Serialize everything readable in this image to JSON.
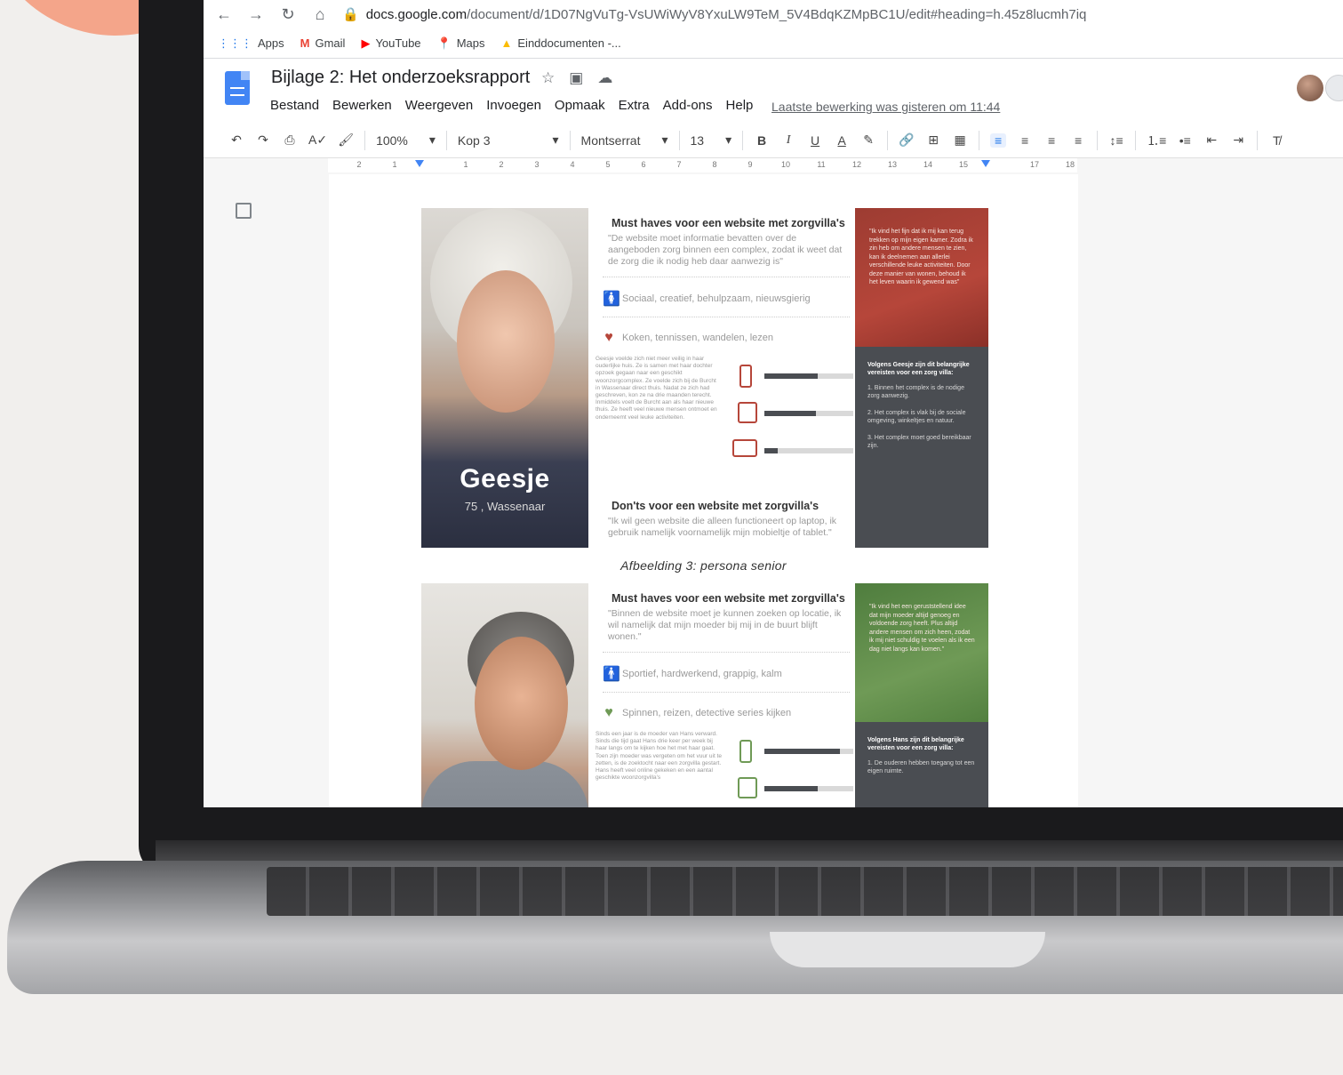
{
  "browser": {
    "url_host": "docs.google.com",
    "url_path": "/document/d/1D07NgVuTg-VsUWiWyV8YxuLW9TeM_5V4BdqKZMpBC1U/edit#heading=h.45z8lucmh7iq",
    "bookmarks": [
      "Apps",
      "Gmail",
      "YouTube",
      "Maps",
      "Einddocumenten -..."
    ]
  },
  "doc": {
    "title": "Bijlage 2: Het onderzoeksrapport",
    "menu": [
      "Bestand",
      "Bewerken",
      "Weergeven",
      "Invoegen",
      "Opmaak",
      "Extra",
      "Add-ons",
      "Help"
    ],
    "last_edit": "Laatste bewerking was gisteren om 11:44"
  },
  "toolbar": {
    "zoom": "100%",
    "style": "Kop 3",
    "font": "Montserrat",
    "size": "13"
  },
  "ruler": [
    "2",
    "1",
    "",
    "1",
    "2",
    "3",
    "4",
    "5",
    "6",
    "7",
    "8",
    "9",
    "10",
    "11",
    "12",
    "13",
    "14",
    "15",
    "",
    "17",
    "18"
  ],
  "persona1": {
    "name": "Geesje",
    "sub": "75 , Wassenaar",
    "must_heading": "Must haves voor een website met zorgvilla's",
    "must_quote": "\"De website moet informatie bevatten over de aangeboden zorg binnen een complex, zodat ik weet dat de zorg die ik nodig heb daar aanwezig is\"",
    "traits": "Sociaal, creatief, behulpzaam, nieuwsgierig",
    "hobbies": "Koken, tennissen, wandelen, lezen",
    "story": "Geesje voelde zich niet meer veilig in haar ouderlijke huis. Ze is samen met haar dochter opzoek gegaan naar een geschikt woonzorgcomplex. Ze voelde zich bij de Burcht in Wassenaar direct thuis. Nadat ze zich had geschreven, kon ze na drie maanden terecht. Inmiddels voelt de Burcht aan als haar nieuwe thuis. Ze heeft veel nieuwe mensen ontmoet en onderneemt veel leuke activiteiten.",
    "device_levels": [
      0.6,
      0.58,
      0.15
    ],
    "dont_heading": "Don'ts voor een website met zorgvilla's",
    "dont_quote": "\"Ik wil geen website die alleen functioneert op laptop, ik gebruik namelijk voornamelijk mijn mobieltje of tablet.\"",
    "side_quote": "\"Ik vind het fijn dat ik mij kan terug trekken op mijn eigen kamer. Zodra ik zin heb om andere mensen te zien, kan ik deelnemen aan allerlei verschillende leuke activiteiten. Door deze manier van wonen, behoud ik het leven waarin ik gewend was\"",
    "side_heading": "Volgens Geesje zijn dit belangrijke vereisten voor een zorg villa:",
    "side_reqs": [
      "1. Binnen het complex is de nodige zorg aanwezig.",
      "2. Het complex is vlak bij de sociale omgeving, winkeltjes en natuur.",
      "3. Het complex moet goed bereikbaar zijn."
    ]
  },
  "caption": "Afbeelding 3: persona senior",
  "persona2": {
    "must_heading": "Must haves voor een website met zorgvilla's",
    "must_quote": "\"Binnen de website moet je kunnen zoeken op locatie, ik wil namelijk dat mijn moeder bij mij in de buurt blijft wonen.\"",
    "traits": "Sportief, hardwerkend, grappig, kalm",
    "hobbies": "Spinnen, reizen, detective series kijken",
    "story": "Sinds een jaar is de moeder van Hans verward. Sinds die tijd gaat Hans drie keer per week bij haar langs om te kijken hoe het met haar gaat. Toen zijn moeder was vergeten om het vuur uit te zetten, is de zoektocht naar een zorgvilla gestart. Hans heeft veel online gekeken en een aantal geschikte woonzorgvilla's",
    "device_levels": [
      0.85,
      0.6
    ],
    "side_quote": "\"Ik vind het een geruststellend idee dat mijn moeder altijd genoeg en voldoende zorg heeft. Plus altijd andere mensen om zich heen, zodat ik mij niet schuldig te voelen als ik een dag niet langs kan komen.\"",
    "side_heading": "Volgens Hans zijn dit belangrijke vereisten voor een zorg villa:",
    "side_reqs": [
      "1. De ouderen hebben toegang tot een eigen ruimte."
    ]
  },
  "colors": {
    "red_accent": "#b6463a",
    "green_accent": "#6f9a56",
    "dark_panel": "#4a4d52",
    "docs_blue": "#4285f4"
  }
}
